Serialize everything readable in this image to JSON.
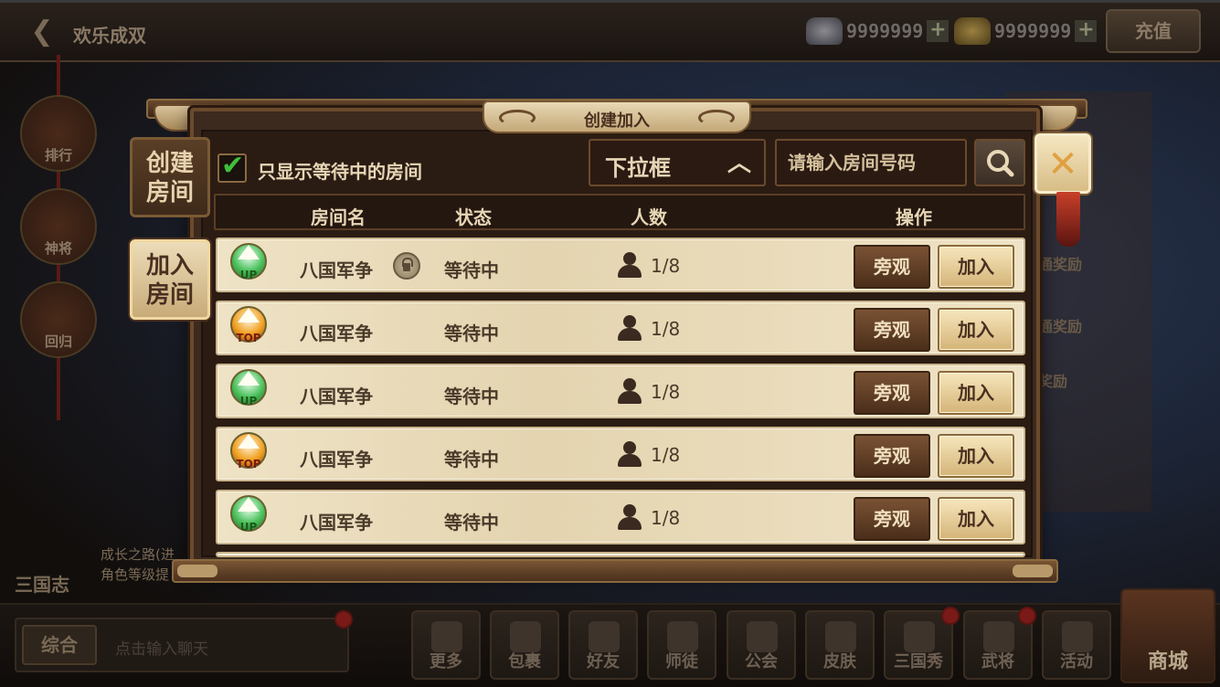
{
  "top": {
    "title": "欢乐成双",
    "silver": "9999999",
    "gold": "9999999",
    "recharge": "充值"
  },
  "side_menu": [
    "排行",
    "神将",
    "回归"
  ],
  "growth": {
    "line1": "成长之路(进",
    "line2": "角色等级提",
    "sanguo": "三国志"
  },
  "behind": {
    "item1": "通奖励",
    "item2": "通奖励",
    "item3": "奖励"
  },
  "chat": {
    "tab": "综合",
    "placeholder": "点击输入聊天"
  },
  "bottom": [
    "更多",
    "包裹",
    "好友",
    "师徒",
    "公会",
    "皮肤",
    "三国秀",
    "武将",
    "活动"
  ],
  "shop": "商城",
  "modal": {
    "title": "创建加入",
    "tab_create": [
      "创建",
      "房间"
    ],
    "tab_join": [
      "加入",
      "房间"
    ],
    "filter_label": "只显示等待中的房间",
    "dropdown": "下拉框",
    "search_placeholder": "请输入房间号码",
    "headers": {
      "name": "房间名",
      "status": "状态",
      "count": "人数",
      "action": "操作"
    },
    "rows": [
      {
        "badge": "UP",
        "name": "八国军争",
        "locked": true,
        "status": "等待中",
        "count": "1/8",
        "watch": "旁观",
        "join": "加入"
      },
      {
        "badge": "TOP",
        "name": "八国军争",
        "locked": false,
        "status": "等待中",
        "count": "1/8",
        "watch": "旁观",
        "join": "加入"
      },
      {
        "badge": "UP",
        "name": "八国军争",
        "locked": false,
        "status": "等待中",
        "count": "1/8",
        "watch": "旁观",
        "join": "加入"
      },
      {
        "badge": "TOP",
        "name": "八国军争",
        "locked": false,
        "status": "等待中",
        "count": "1/8",
        "watch": "旁观",
        "join": "加入"
      },
      {
        "badge": "UP",
        "name": "八国军争",
        "locked": false,
        "status": "等待中",
        "count": "1/8",
        "watch": "旁观",
        "join": "加入"
      }
    ]
  }
}
